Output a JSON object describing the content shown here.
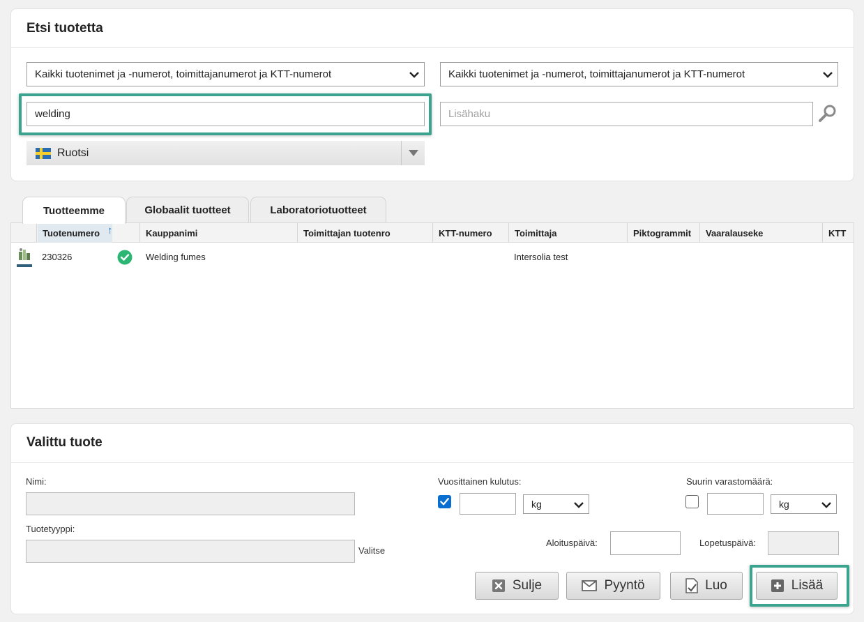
{
  "search_panel": {
    "title": "Etsi tuotetta",
    "search_scope_left": "Kaikki tuotenimet ja -numerot, toimittajanumerot ja KTT-numerot",
    "search_scope_right": "Kaikki tuotenimet ja -numerot, toimittajanumerot ja KTT-numerot",
    "search_value": "welding",
    "extra_search_placeholder": "Lisähaku",
    "country": "Ruotsi",
    "country_flag": "sweden-flag-icon"
  },
  "tabs": [
    {
      "label": "Tuotteemme",
      "active": true
    },
    {
      "label": "Globaalit tuotteet",
      "active": false
    },
    {
      "label": "Laboratoriotuotteet",
      "active": false
    }
  ],
  "table": {
    "columns": [
      "Tuotenumero",
      "Kauppanimi",
      "Toimittajan tuotenro",
      "KTT-numero",
      "Toimittaja",
      "Piktogrammit",
      "Vaaralauseke",
      "KTT"
    ],
    "sort_indicator": "↑",
    "rows": [
      {
        "number": "230326",
        "status": "approved",
        "trade_name": "Welding fumes",
        "supplier_no": "",
        "ktt_no": "",
        "supplier": "Intersolia test",
        "pictograms": "",
        "hazard": "",
        "ktt": ""
      }
    ]
  },
  "selected_panel": {
    "title": "Valittu tuote",
    "name_label": "Nimi:",
    "name_value": "",
    "type_label": "Tuotetyyppi:",
    "type_value": "",
    "choose_label": "Valitse",
    "annual_label": "Vuosittainen kulutus:",
    "annual_checked": true,
    "annual_value": "",
    "annual_unit": "kg",
    "max_storage_label": "Suurin varastomäärä:",
    "max_storage_checked": false,
    "max_storage_value": "",
    "max_storage_unit": "kg",
    "start_date_label": "Aloituspäivä:",
    "start_date_value": "",
    "end_date_label": "Lopetuspäivä:",
    "end_date_value": ""
  },
  "buttons": {
    "close": "Sulje",
    "request": "Pyyntö",
    "create": "Luo",
    "add": "Lisää"
  },
  "colors": {
    "highlight": "#3ba48f",
    "checkbox_blue": "#0a6ed1",
    "status_green": "#2bb673",
    "sort_arrow": "#1a6fb5"
  }
}
